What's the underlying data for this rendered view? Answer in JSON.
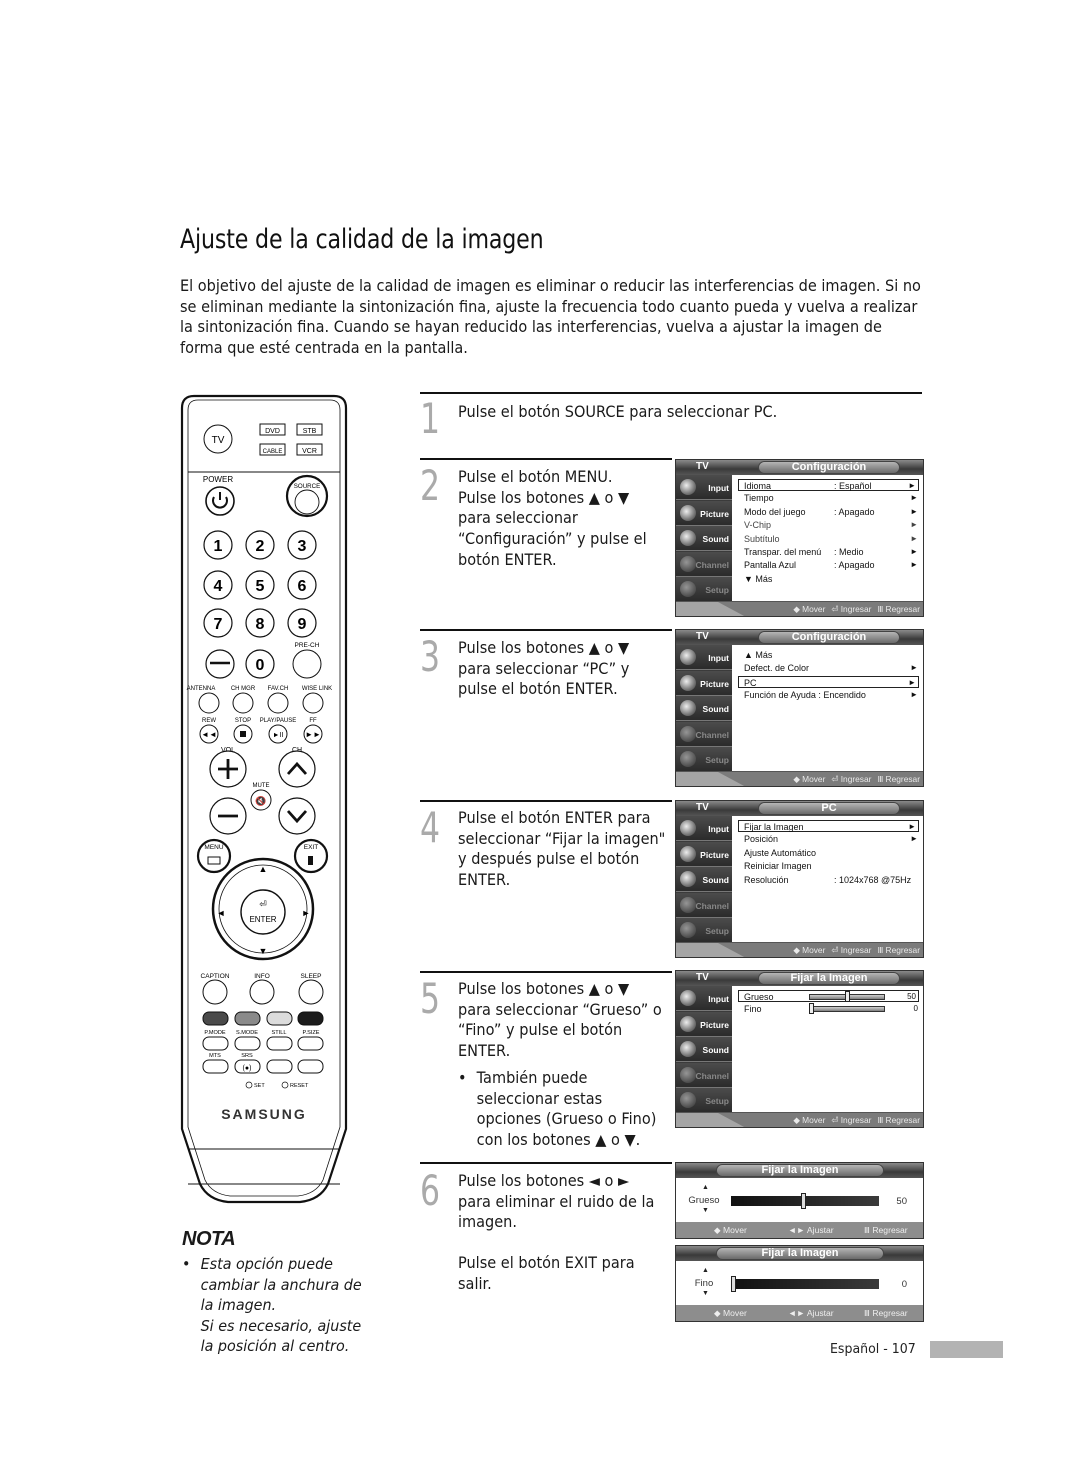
{
  "page": {
    "title": "Ajuste de la calidad de la imagen",
    "intro": "El objetivo del ajuste de la calidad de imagen es eliminar o reducir las interferencias de imagen. Si no se eliminan mediante la sintonización fina, ajuste la frecuencia todo cuanto pueda y vuelva a realizar la sintonización fina. Cuando se hayan reducido las interferencias, vuelva a ajustar la imagen de forma que esté centrada en la pantalla.",
    "footer": "Español - 107"
  },
  "remote": {
    "brand": "SAMSUNG",
    "mode_buttons": [
      "TV",
      "DVD",
      "STB",
      "CABLE",
      "VCR"
    ],
    "labels": {
      "power": "POWER",
      "source": "SOURCE",
      "prech": "PRE-CH",
      "antenna": "ANTENNA",
      "chmgr": "CH MGR",
      "favch": "FAV.CH",
      "wiselink": "WISE LINK",
      "rew": "REW",
      "stop": "STOP",
      "playpause": "PLAY/PAUSE",
      "ff": "FF",
      "vol": "VOL",
      "ch": "CH",
      "mute": "MUTE",
      "menu": "MENU",
      "exit": "EXIT",
      "enter": "ENTER",
      "caption": "CAPTION",
      "info": "INFO",
      "sleep": "SLEEP",
      "pmode": "P.MODE",
      "smode": "S.MODE",
      "still": "STILL",
      "psize": "P.SIZE",
      "mts": "MTS",
      "srs": "SRS",
      "set": "SET",
      "reset": "RESET"
    },
    "digits": [
      "1",
      "2",
      "3",
      "4",
      "5",
      "6",
      "7",
      "8",
      "9",
      "0"
    ]
  },
  "nota": {
    "title": "NOTA",
    "bullet": "•",
    "text_1": "Esta opción puede",
    "text_2": "cambiar la anchura de",
    "text_3": "la imagen.",
    "text_4": "Si es necesario, ajuste",
    "text_5": "la posición al centro."
  },
  "steps": [
    {
      "num": "1",
      "lines": [
        "Pulse el botón SOURCE para seleccionar PC."
      ]
    },
    {
      "num": "2",
      "lines": [
        "Pulse el botón MENU.",
        "Pulse los botones ▲ o ▼",
        "para seleccionar",
        "“Configuración” y pulse el",
        "botón ENTER."
      ]
    },
    {
      "num": "3",
      "lines": [
        "Pulse los botones ▲ o ▼",
        "para seleccionar “PC” y",
        "pulse el botón ENTER."
      ]
    },
    {
      "num": "4",
      "lines": [
        "Pulse el botón ENTER para",
        "seleccionar “Fijar la imagen\"",
        "y después pulse el botón",
        "ENTER."
      ]
    },
    {
      "num": "5",
      "lines": [
        "Pulse los botones ▲ o ▼",
        "para seleccionar “Grueso” o",
        "“Fino” y pulse el botón",
        "ENTER."
      ],
      "bullet": "•",
      "sub": [
        "También puede",
        "seleccionar estas",
        "opciones (Grueso o Fino)",
        "con los botones ▲ o ▼."
      ]
    },
    {
      "num": "6",
      "lines": [
        "Pulse los botones ◄ o ►",
        "para eliminar el ruido de la",
        "imagen."
      ],
      "extra": [
        "Pulse el botón EXIT para",
        "salir."
      ]
    }
  ],
  "osd": {
    "tv_label": "TV",
    "sidebar": [
      "Input",
      "Picture",
      "Sound",
      "Channel",
      "Setup"
    ],
    "footer": {
      "move": "◆ Mover",
      "enter": "⏎ Ingresar",
      "back": "Ⅲ Regresar"
    },
    "screen1": {
      "title": "Configuración",
      "rows": [
        {
          "label": "Idioma",
          "value": ": Español",
          "arrow": "►",
          "selected": true
        },
        {
          "label": "Tiempo",
          "value": "",
          "arrow": "►"
        },
        {
          "label": "Modo del juego",
          "value": ": Apagado",
          "arrow": "►"
        },
        {
          "label": "V-Chip",
          "value": "",
          "arrow": "►",
          "dim": true
        },
        {
          "label": "Subtítulo",
          "value": "",
          "arrow": "►",
          "dim": true
        },
        {
          "label": "Transpar. del menú",
          "value": ": Medio",
          "arrow": "►"
        },
        {
          "label": "Pantalla Azul",
          "value": ": Apagado",
          "arrow": "►"
        },
        {
          "label": "▼ Más",
          "value": "",
          "arrow": ""
        }
      ]
    },
    "screen2": {
      "title": "Configuración",
      "rows": [
        {
          "label": "▲ Más",
          "value": "",
          "arrow": ""
        },
        {
          "label": "Defect. de Color",
          "value": "",
          "arrow": "►"
        },
        {
          "label": "PC",
          "value": "",
          "arrow": "►",
          "selected": true
        },
        {
          "label": "Función de Ayuda : Encendido",
          "value": "",
          "arrow": "►"
        }
      ]
    },
    "screen3": {
      "title": "PC",
      "rows": [
        {
          "label": "Fijar la Imagen",
          "value": "",
          "arrow": "►",
          "selected": true
        },
        {
          "label": "Posición",
          "value": "",
          "arrow": "►"
        },
        {
          "label": "Ajuste Automático",
          "value": "",
          "arrow": ""
        },
        {
          "label": "Reiniciar Imagen",
          "value": "",
          "arrow": ""
        },
        {
          "label": "Resolución",
          "value": ": 1024x768 @75Hz",
          "arrow": ""
        }
      ]
    },
    "screen4": {
      "title": "Fijar la Imagen",
      "sliders": [
        {
          "label": "Grueso",
          "value": "50",
          "fraction": 0.5,
          "selected": true
        },
        {
          "label": "Fino",
          "value": "0",
          "fraction": 0.0
        }
      ]
    },
    "bar_screens": [
      {
        "title": "Fijar la Imagen",
        "label": "Grueso",
        "value": "50",
        "fraction": 0.5
      },
      {
        "title": "Fijar la Imagen",
        "label": "Fino",
        "value": "0",
        "fraction": 0.0
      }
    ],
    "bar_footer": {
      "move": "◆ Mover",
      "adjust": "◄► Ajustar",
      "back": "Ⅲ Regresar"
    }
  }
}
